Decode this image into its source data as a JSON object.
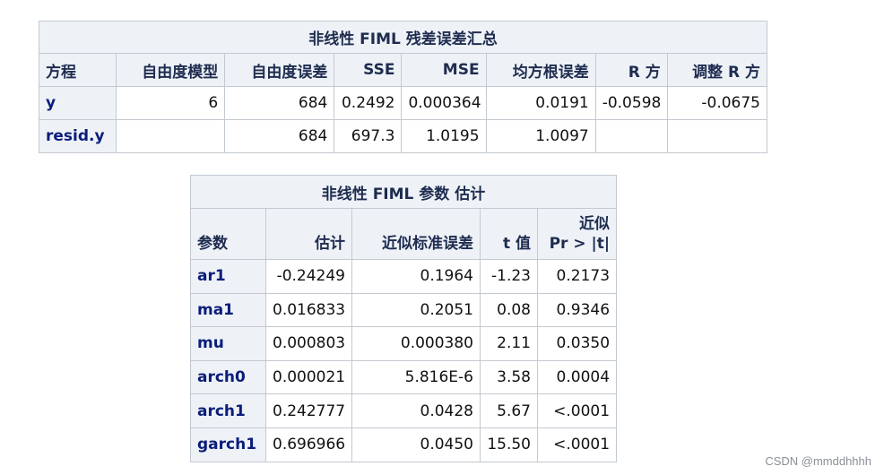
{
  "table1": {
    "title": "非线性 FIML 残差误差汇总",
    "headers": [
      "方程",
      "自由度模型",
      "自由度误差",
      "SSE",
      "MSE",
      "均方根误差",
      "R 方",
      "调整 R 方"
    ],
    "rows": [
      [
        "y",
        "6",
        "684",
        "0.2492",
        "0.000364",
        "0.0191",
        "-0.0598",
        "-0.0675"
      ],
      [
        "resid.y",
        "",
        "684",
        "697.3",
        "1.0195",
        "1.0097",
        "",
        ""
      ]
    ]
  },
  "table2": {
    "title": "非线性 FIML 参数 估计",
    "headers": [
      "参数",
      "估计",
      "近似标准误差",
      "t 值",
      "近似",
      "Pr > |t|"
    ],
    "rows": [
      [
        "ar1",
        "-0.24249",
        "0.1964",
        "-1.23",
        "0.2173"
      ],
      [
        "ma1",
        "0.016833",
        "0.2051",
        "0.08",
        "0.9346"
      ],
      [
        "mu",
        "0.000803",
        "0.000380",
        "2.11",
        "0.0350"
      ],
      [
        "arch0",
        "0.000021",
        "5.816E-6",
        "3.58",
        "0.0004"
      ],
      [
        "arch1",
        "0.242777",
        "0.0428",
        "5.67",
        "<.0001"
      ],
      [
        "garch1",
        "0.696966",
        "0.0450",
        "15.50",
        "<.0001"
      ]
    ]
  },
  "watermark": "CSDN @mmddhhhh"
}
